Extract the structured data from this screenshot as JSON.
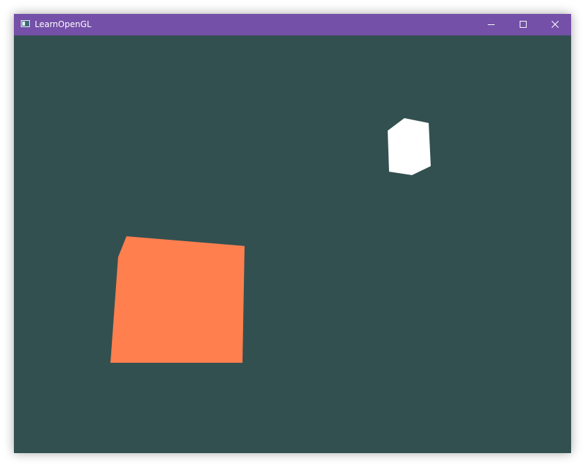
{
  "window": {
    "title": "LearnOpenGL",
    "titlebar_color": "#7450a8",
    "clear_color": "#335050"
  },
  "titlebar_controls": {
    "minimize_icon": "minimize-icon",
    "maximize_icon": "maximize-icon",
    "close_icon": "close-icon"
  },
  "scene": {
    "objects": [
      {
        "name": "object-cube",
        "color": "#ff7f4f"
      },
      {
        "name": "light-cube",
        "color": "#ffffff"
      }
    ]
  }
}
